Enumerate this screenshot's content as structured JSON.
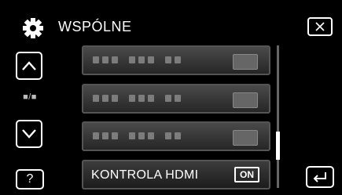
{
  "header": {
    "title": "WSPÓLNE",
    "settings_icon": "gear-icon",
    "close_icon": "close-icon"
  },
  "nav": {
    "up_icon": "chevron-up-icon",
    "down_icon": "chevron-down-icon",
    "page_indicator": "■/■",
    "help_label": "?",
    "back_icon": "return-arrow-icon"
  },
  "menu": {
    "items": [
      {
        "label": "",
        "value": ""
      },
      {
        "label": "",
        "value": ""
      },
      {
        "label": "",
        "value": ""
      },
      {
        "label": "KONTROLA HDMI",
        "value": "ON"
      }
    ]
  },
  "colors": {
    "background": "#000000",
    "row": "#3a3a3a",
    "text": "#ffffff"
  }
}
